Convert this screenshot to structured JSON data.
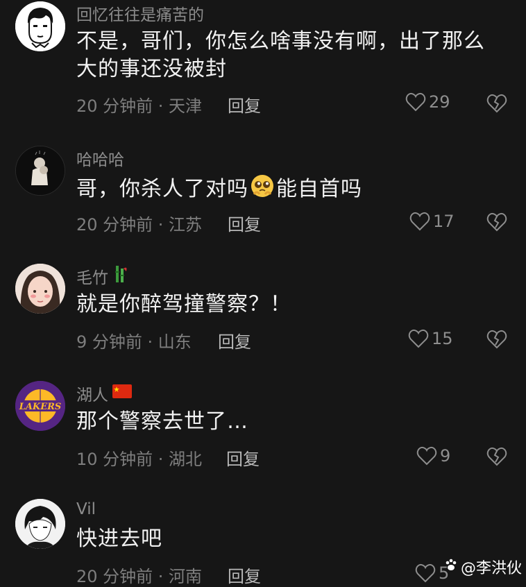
{
  "comments": [
    {
      "username": "回忆往往是痛苦的",
      "text": "不是，哥们，你怎么啥事没有啊，出了那么大的事还没被封",
      "time": "20 分钟前 · 天津",
      "reply_label": "回复",
      "likes": "29",
      "avatar_icon": "cartoon-boy-avatar"
    },
    {
      "username": "哈哈哈",
      "text_before": "哥，你杀人了对吗",
      "text_after": "能自首吗",
      "time": "20 分钟前 · 江苏",
      "reply_label": "回复",
      "likes": "17",
      "avatar_icon": "hugging-figure-avatar"
    },
    {
      "username": "毛竹",
      "text": "就是你醉驾撞警察？！",
      "time": "9 分钟前 · 山东",
      "reply_label": "回复",
      "likes": "15",
      "avatar_icon": "girl-photo-avatar"
    },
    {
      "username": "湖人",
      "text": "那个警察去世了…",
      "time": "10 分钟前 · 湖北",
      "reply_label": "回复",
      "likes": "9",
      "avatar_icon": "lakers-logo-avatar",
      "avatar_text": "LAKERS"
    },
    {
      "username": "Vil",
      "text": "快进去吧",
      "time": "20 分钟前 · 河南",
      "reply_label": "回复",
      "likes": "5",
      "avatar_icon": "anime-boy-avatar"
    }
  ],
  "watermark": {
    "text": "@李洪伙"
  },
  "colors": {
    "background": "#161616",
    "text": "#f2f2f2",
    "muted": "#8c8c8c",
    "lakers_purple": "#552583",
    "lakers_gold": "#fdb927"
  }
}
